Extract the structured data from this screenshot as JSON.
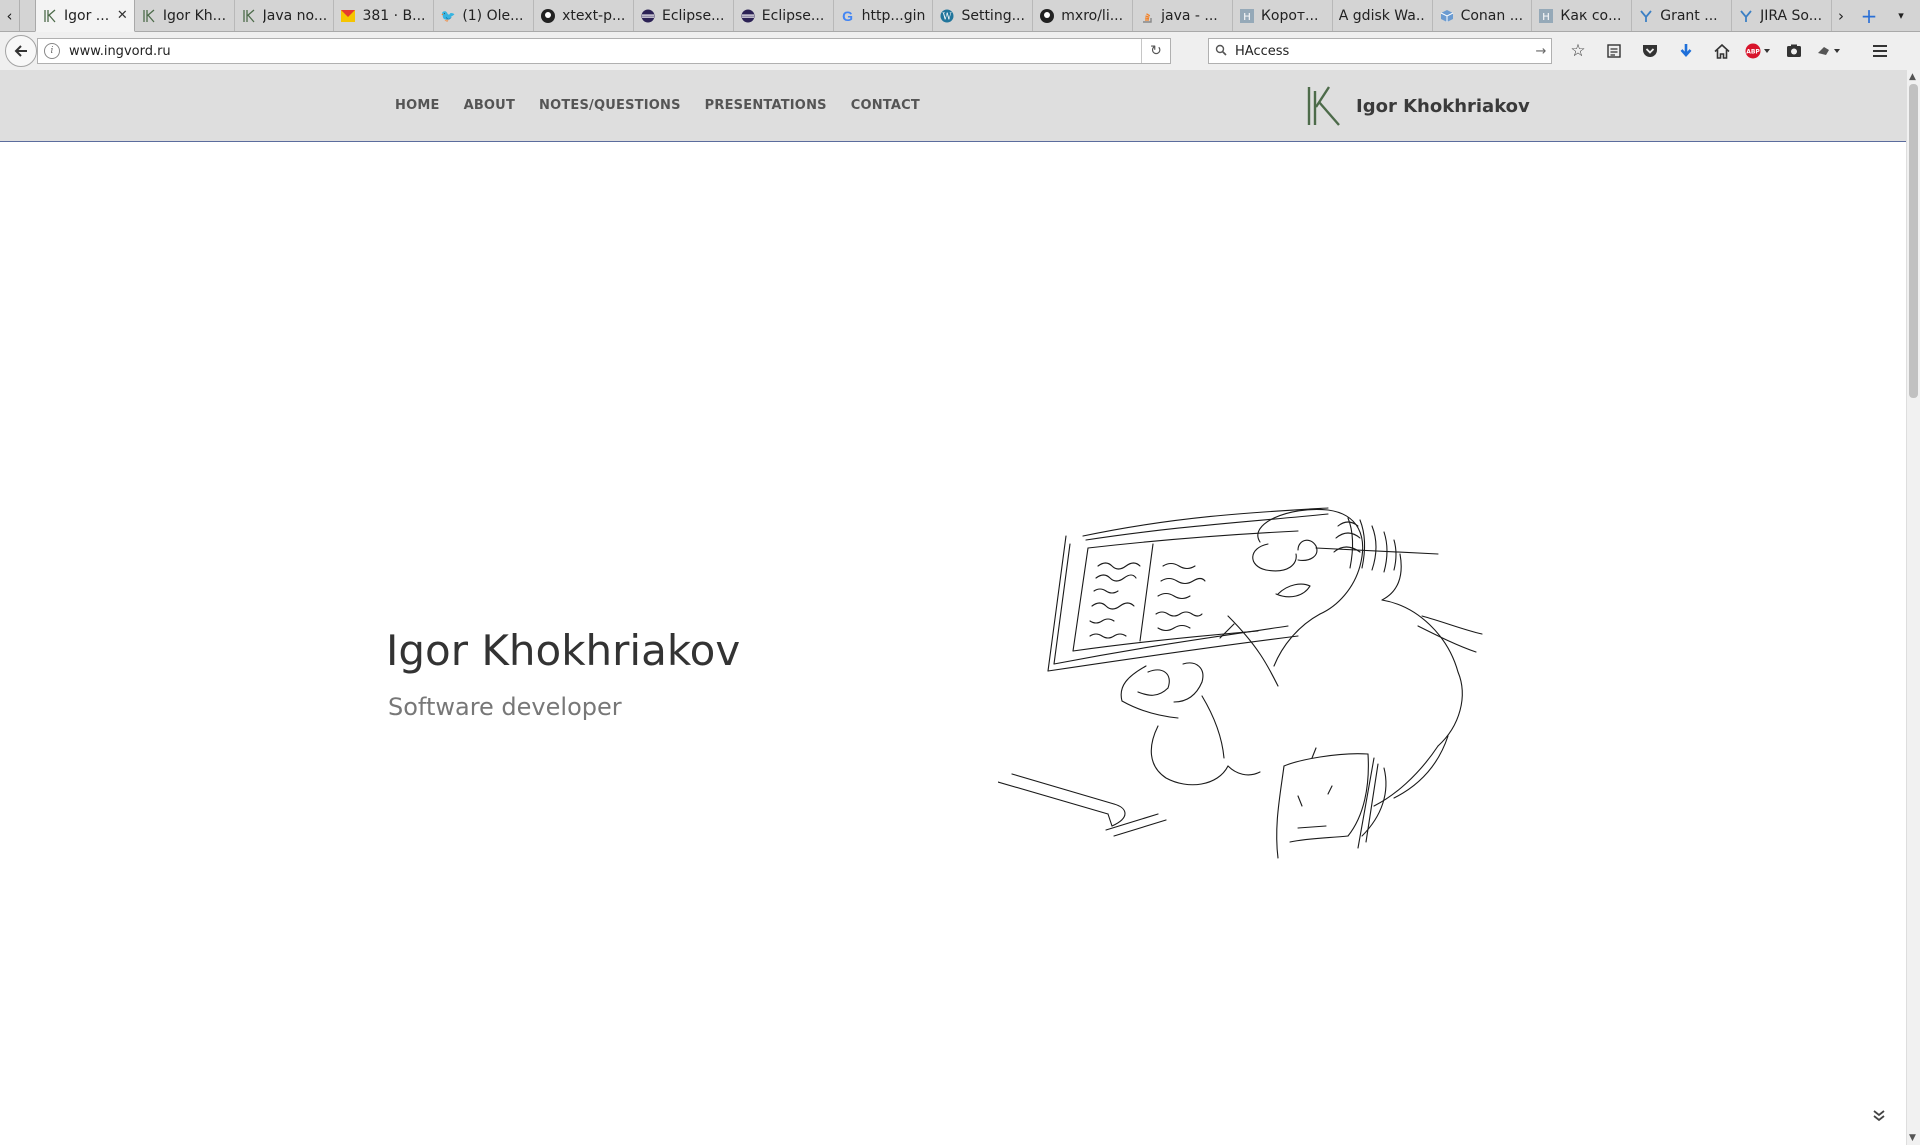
{
  "browser": {
    "tabs": [
      {
        "label": "Igor ...",
        "icon": "ik-logo-icon",
        "active": true,
        "closable": true
      },
      {
        "label": "Igor Kh...",
        "icon": "ik-logo-icon"
      },
      {
        "label": "Java no...",
        "icon": "ik-logo-icon"
      },
      {
        "label": "381 · B...",
        "icon": "mail-icon"
      },
      {
        "label": "(1) Ole...",
        "icon": "twitter-icon"
      },
      {
        "label": "xtext-p...",
        "icon": "github-icon"
      },
      {
        "label": "Eclipse...",
        "icon": "eclipse-icon"
      },
      {
        "label": "Eclipse...",
        "icon": "eclipse-icon"
      },
      {
        "label": "http...gin",
        "icon": "google-icon"
      },
      {
        "label": "Setting...",
        "icon": "wordpress-icon"
      },
      {
        "label": "mxro/li...",
        "icon": "github-icon"
      },
      {
        "label": "java - ...",
        "icon": "stackoverflow-icon"
      },
      {
        "label": "Корот...",
        "icon": "habr-icon"
      },
      {
        "label": "A gdisk Wa...",
        "icon": ""
      },
      {
        "label": "Conan ...",
        "icon": "cube-icon"
      },
      {
        "label": "Как со...",
        "icon": "habr-icon"
      },
      {
        "label": "Grant ...",
        "icon": "jira-icon"
      },
      {
        "label": "JIRA So...",
        "icon": "jira-icon"
      }
    ],
    "url": "www.ingvord.ru",
    "search_value": "HAccess"
  },
  "site": {
    "menu": [
      "HOME",
      "ABOUT",
      "NOTES/QUESTIONS",
      "PRESENTATIONS",
      "CONTACT"
    ],
    "brand_name": "Igor Khokhriakov",
    "hero": {
      "name": "Igor Khokhriakov",
      "role": "Software developer"
    }
  },
  "colors": {
    "header_bg": "#dedede",
    "header_border": "#5b6c9d",
    "logo_green": "#4d6b4a"
  }
}
